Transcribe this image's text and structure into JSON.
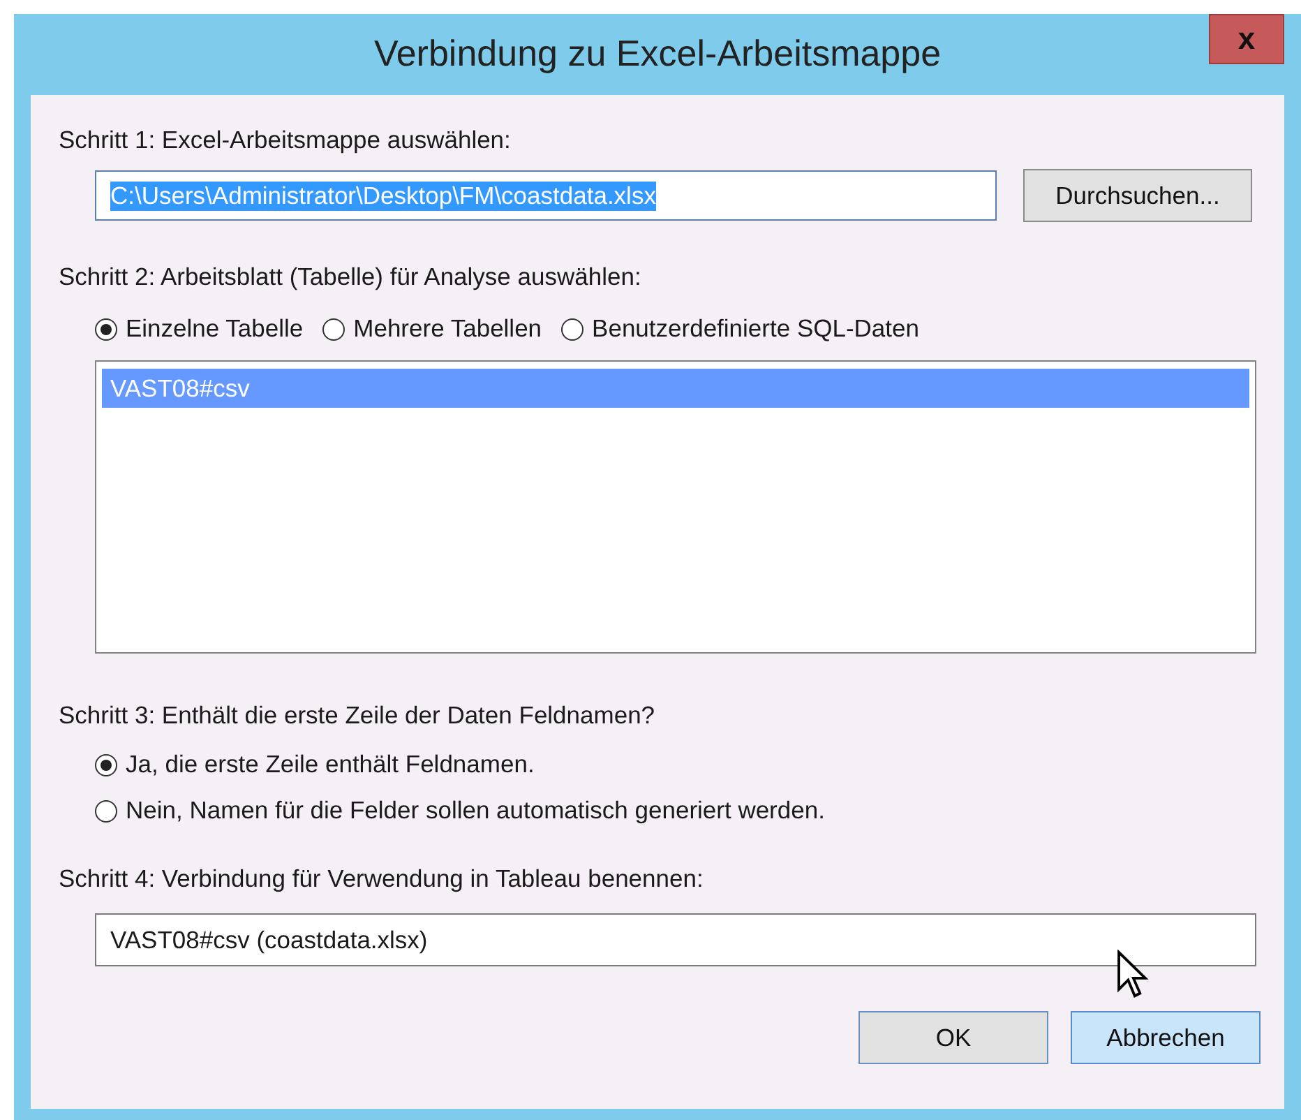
{
  "window": {
    "title": "Verbindung zu Excel-Arbeitsmappe",
    "close": "x"
  },
  "step1": {
    "label": "Schritt 1: Excel-Arbeitsmappe auswählen:",
    "path": "C:\\Users\\Administrator\\Desktop\\FM\\coastdata.xlsx",
    "text_selected": true,
    "browse": "Durchsuchen..."
  },
  "step2": {
    "label": "Schritt 2: Arbeitsblatt (Tabelle) für Analyse auswählen:",
    "options": [
      {
        "label": "Einzelne Tabelle",
        "selected": true
      },
      {
        "label": "Mehrere Tabellen",
        "selected": false
      },
      {
        "label": "Benutzerdefinierte SQL-Daten",
        "selected": false
      }
    ],
    "sheets": [
      {
        "name": "VAST08#csv",
        "selected": true
      }
    ]
  },
  "step3": {
    "label": "Schritt 3: Enthält die erste Zeile der Daten Feldnamen?",
    "options": [
      {
        "label": "Ja, die erste Zeile enthält Feldnamen.",
        "selected": true
      },
      {
        "label": "Nein, Namen für die Felder sollen automatisch generiert werden.",
        "selected": false
      }
    ]
  },
  "step4": {
    "label": "Schritt 4: Verbindung für Verwendung in Tableau benennen:",
    "name": "VAST08#csv (coastdata.xlsx)"
  },
  "buttons": [
    {
      "label": "OK",
      "highlighted": false
    },
    {
      "label": "Abbrechen",
      "highlighted": true
    }
  ]
}
